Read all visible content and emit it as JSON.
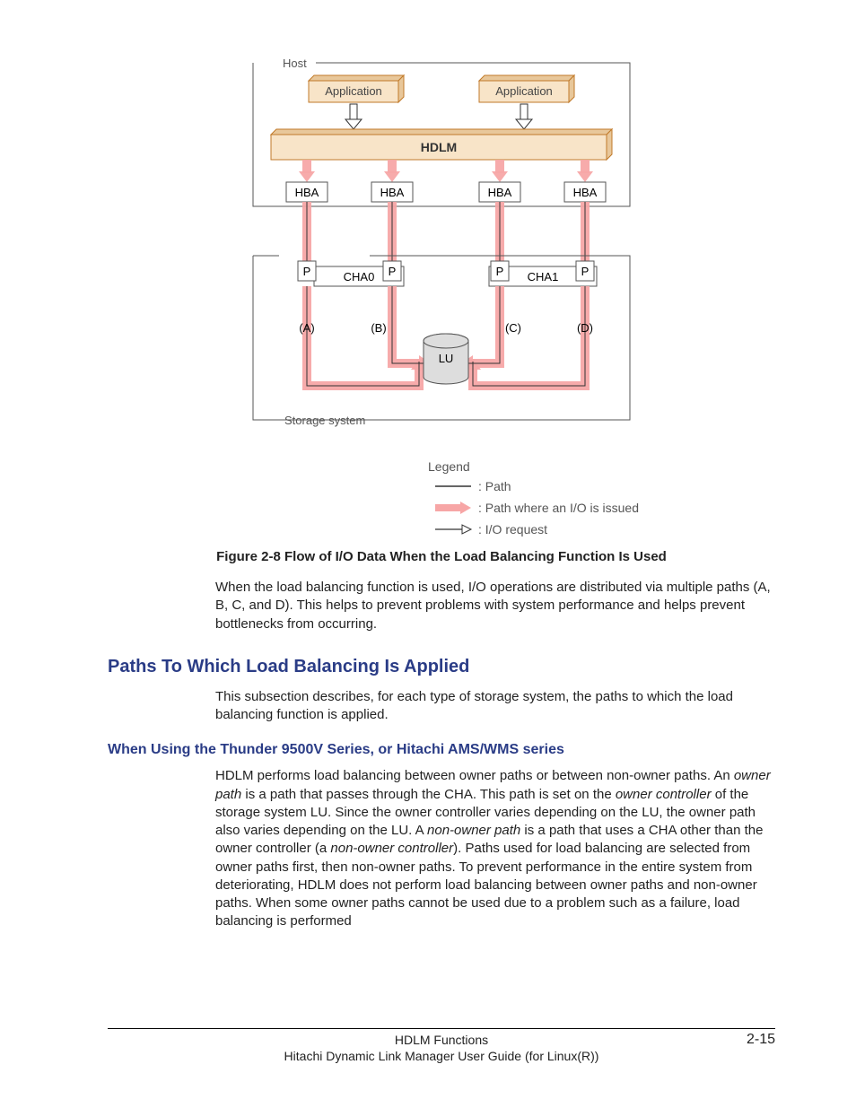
{
  "diagram": {
    "host_label": "Host",
    "app1": "Application",
    "app2": "Application",
    "hdlm": "HDLM",
    "hba": "HBA",
    "p": "P",
    "cha0": "CHA0",
    "cha1": "CHA1",
    "paths": {
      "a": "(A)",
      "b": "(B)",
      "c": "(C)",
      "d": "(D)"
    },
    "lu": "LU",
    "storage_label": "Storage system"
  },
  "legend": {
    "title": "Legend",
    "path": ": Path",
    "issued": ": Path where an I/O is issued",
    "io": ": I/O request"
  },
  "caption": "Figure 2-8 Flow of I/O Data When the Load Balancing Function Is Used",
  "para1": "When the load balancing function is used, I/O operations are distributed via multiple paths (A, B, C, and D). This helps to prevent problems with system performance and helps prevent bottlenecks from occurring.",
  "section_heading": "Paths To Which Load Balancing Is Applied",
  "para2": "This subsection describes, for each type of storage system, the paths to which the load balancing function is applied.",
  "subsection_heading": "When Using the Thunder 9500V Series, or Hitachi AMS/WMS series",
  "para3_pre": "HDLM performs load balancing between owner paths or between non-owner paths. An ",
  "para3_i1": "owner path",
  "para3_mid1": " is a path that passes through the CHA. This path is set on the ",
  "para3_i2": "owner controller",
  "para3_mid2": " of the storage system LU. Since the owner controller varies depending on the LU, the owner path also varies depending on the LU. A ",
  "para3_i3": "non-owner path",
  "para3_mid3": " is a path that uses a CHA other than the owner controller (a ",
  "para3_i4": "non-owner controller",
  "para3_post": "). Paths used for load balancing are selected from owner paths first, then non-owner paths. To prevent performance in the entire system from deteriorating, HDLM does not perform load balancing between owner paths and non-owner paths. When some owner paths cannot be used due to a problem such as a failure, load balancing is performed",
  "footer": {
    "line1": "HDLM Functions",
    "line2": "Hitachi Dynamic Link Manager User Guide (for Linux(R))",
    "page": "2-15"
  }
}
